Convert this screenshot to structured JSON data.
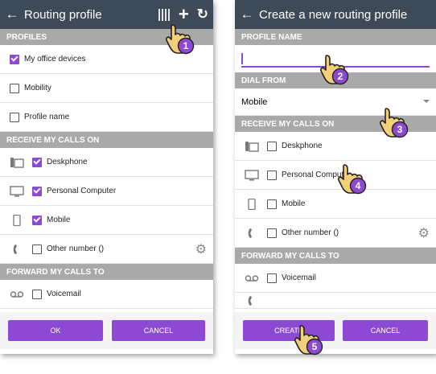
{
  "left": {
    "title": "Routing profile",
    "profiles_header": "PROFILES",
    "profiles": [
      {
        "label": "My office devices",
        "checked": true
      },
      {
        "label": "Mobility",
        "checked": false
      },
      {
        "label": "Profile name",
        "checked": false
      }
    ],
    "receive_header": "RECEIVE MY CALLS ON",
    "receive": [
      {
        "icon": "deskphone-icon",
        "label": "Deskphone",
        "checked": true
      },
      {
        "icon": "computer-icon",
        "label": "Personal Computer",
        "checked": true
      },
      {
        "icon": "mobile-icon",
        "label": "Mobile",
        "checked": true
      },
      {
        "icon": "phone-handset-icon",
        "label": "Other number ()",
        "checked": false
      }
    ],
    "forward_header": "FORWARD MY CALLS TO",
    "forward": [
      {
        "icon": "voicemail-icon",
        "label": "Voicemail",
        "checked": false
      }
    ],
    "ok_label": "OK",
    "cancel_label": "CANCEL",
    "step": "1"
  },
  "right": {
    "title": "Create a new routing profile",
    "name_header": "PROFILE NAME",
    "name_value": "",
    "dial_header": "DIAL FROM",
    "dial_value": "Mobile",
    "receive_header": "RECEIVE MY CALLS ON",
    "receive": [
      {
        "icon": "deskphone-icon",
        "label": "Deskphone",
        "checked": false
      },
      {
        "icon": "computer-icon",
        "label": "Personal Computer",
        "checked": false
      },
      {
        "icon": "mobile-icon",
        "label": "Mobile",
        "checked": false
      },
      {
        "icon": "phone-handset-icon",
        "label": "Other number ()",
        "checked": false
      }
    ],
    "forward_header": "FORWARD MY CALLS TO",
    "forward": [
      {
        "icon": "voicemail-icon",
        "label": "Voicemail",
        "checked": false
      }
    ],
    "create_label": "CREATE",
    "cancel_label": "CANCEL",
    "steps": [
      "2",
      "3",
      "4",
      "5"
    ]
  },
  "colors": {
    "appbar": "#3e4a57",
    "accent": "#8e49d4",
    "section": "#a9a9a9",
    "hand": "#f2cf7a"
  }
}
